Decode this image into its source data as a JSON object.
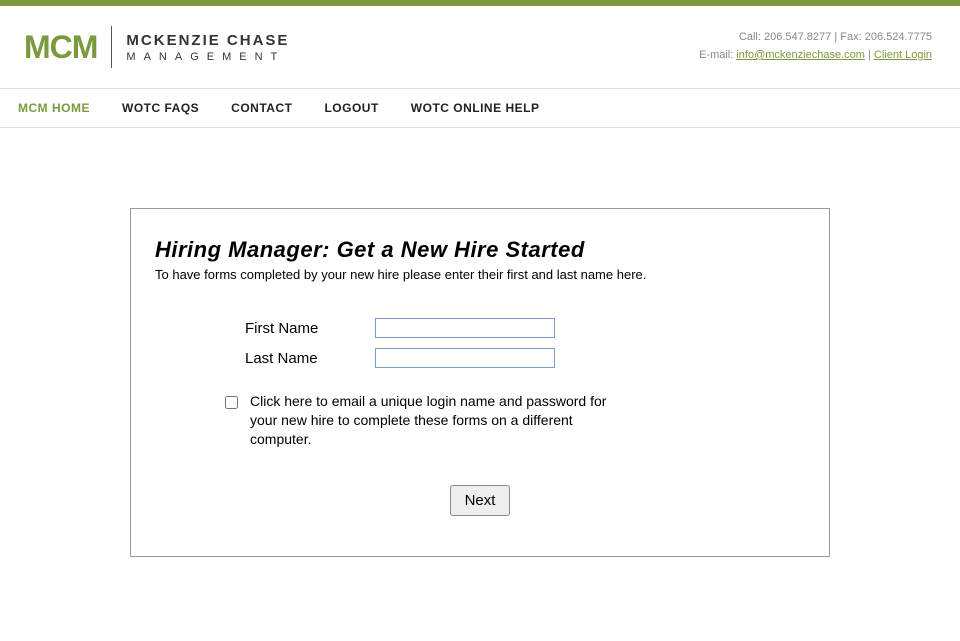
{
  "header": {
    "logo_abbrev": "MCM",
    "logo_line1": "MCKENZIE CHASE",
    "logo_line2": "MANAGEMENT",
    "contact_call_prefix": "Call: ",
    "contact_call_number": "206.547.8277",
    "contact_separator": " | ",
    "contact_fax_prefix": "Fax: ",
    "contact_fax_number": "206.524.7775",
    "contact_email_prefix": "E-mail: ",
    "contact_email": "info@mckenziechase.com",
    "client_login": "Client Login"
  },
  "nav": {
    "items": [
      {
        "label": "MCM HOME",
        "active": true
      },
      {
        "label": "WOTC FAQS",
        "active": false
      },
      {
        "label": "CONTACT",
        "active": false
      },
      {
        "label": "LOGOUT",
        "active": false
      },
      {
        "label": "WOTC ONLINE HELP",
        "active": false
      }
    ]
  },
  "form": {
    "title": "Hiring Manager: Get a New Hire Started",
    "subtitle": "To have forms completed by your new hire please enter their first and last name here.",
    "first_name_label": "First Name",
    "last_name_label": "Last Name",
    "first_name_value": "",
    "last_name_value": "",
    "checkbox_label": "Click here to email a unique login name and password for your new hire to complete these forms on a different computer.",
    "next_button": "Next"
  }
}
